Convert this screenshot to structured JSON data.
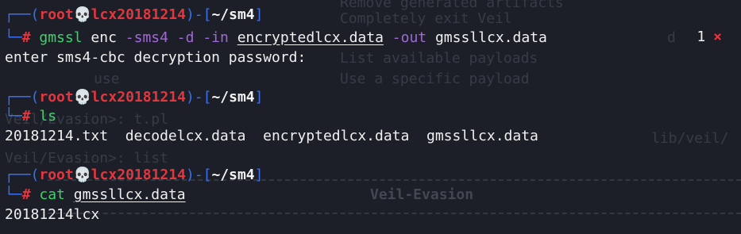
{
  "background_ghost": {
    "lines": [
      "Remove generated artifacts",
      "Completely exit Veil",
      "d",
      "List available payloads",
      "Use a specific payload",
      "use",
      "Veil/Evasion>: t.pl",
      "Veil/Evasion>: list",
      "lib/veil/",
      "Veil-Evasion"
    ]
  },
  "prompts": [
    {
      "user": "root",
      "skull": "💀",
      "host": "lcx20181214",
      "dir": "~/sm4",
      "hash": "#",
      "command": "gmssl",
      "args": [
        {
          "text": "enc",
          "kind": "plain"
        },
        {
          "text": "-sms4",
          "kind": "opt"
        },
        {
          "text": "-d",
          "kind": "opt"
        },
        {
          "text": "-in",
          "kind": "opt"
        },
        {
          "text": "encryptedlcx.data",
          "kind": "file"
        },
        {
          "text": "-out",
          "kind": "opt"
        },
        {
          "text": "gmssllcx.data",
          "kind": "plain"
        }
      ],
      "status_code": "1",
      "status_icon": "×",
      "output": [
        "enter sms4-cbc decryption password:"
      ]
    },
    {
      "user": "root",
      "skull": "💀",
      "host": "lcx20181214",
      "dir": "~/sm4",
      "hash": "#",
      "command": "ls",
      "args": [],
      "output": [
        "20181214.txt  decodelcx.data  encryptedlcx.data  gmssllcx.data"
      ]
    },
    {
      "user": "root",
      "skull": "💀",
      "host": "lcx20181214",
      "dir": "~/sm4",
      "hash": "#",
      "command": "cat",
      "args": [
        {
          "text": "gmssllcx.data",
          "kind": "file"
        }
      ],
      "output": [
        "20181214lcx"
      ]
    }
  ],
  "colors": {
    "background": "#1c1f27",
    "box_drawing": "#3a6ff0",
    "root_host": "#e4363f",
    "command": "#3dd26b",
    "option": "#a268d6",
    "text": "#f0f0f0"
  }
}
